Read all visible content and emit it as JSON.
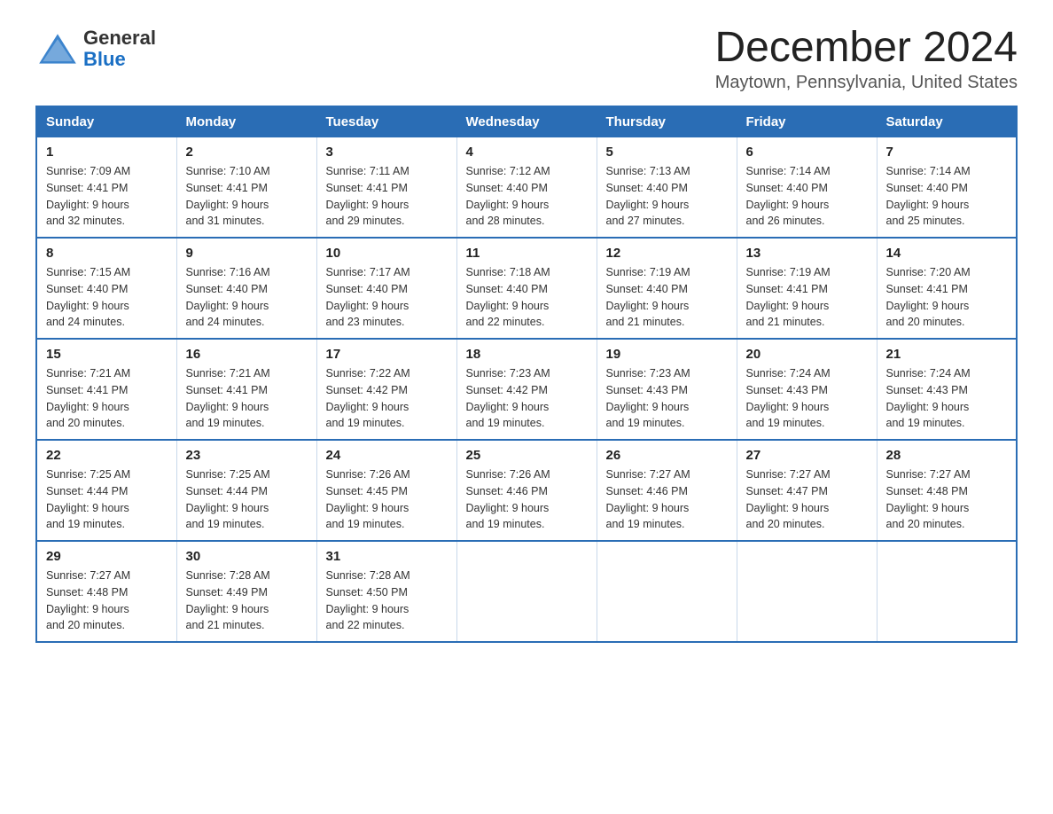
{
  "header": {
    "logo_line1": "General",
    "logo_line2": "Blue",
    "title": "December 2024",
    "location": "Maytown, Pennsylvania, United States"
  },
  "days_of_week": [
    "Sunday",
    "Monday",
    "Tuesday",
    "Wednesday",
    "Thursday",
    "Friday",
    "Saturday"
  ],
  "weeks": [
    [
      {
        "day": "1",
        "sunrise": "7:09 AM",
        "sunset": "4:41 PM",
        "daylight": "9 hours and 32 minutes."
      },
      {
        "day": "2",
        "sunrise": "7:10 AM",
        "sunset": "4:41 PM",
        "daylight": "9 hours and 31 minutes."
      },
      {
        "day": "3",
        "sunrise": "7:11 AM",
        "sunset": "4:41 PM",
        "daylight": "9 hours and 29 minutes."
      },
      {
        "day": "4",
        "sunrise": "7:12 AM",
        "sunset": "4:40 PM",
        "daylight": "9 hours and 28 minutes."
      },
      {
        "day": "5",
        "sunrise": "7:13 AM",
        "sunset": "4:40 PM",
        "daylight": "9 hours and 27 minutes."
      },
      {
        "day": "6",
        "sunrise": "7:14 AM",
        "sunset": "4:40 PM",
        "daylight": "9 hours and 26 minutes."
      },
      {
        "day": "7",
        "sunrise": "7:14 AM",
        "sunset": "4:40 PM",
        "daylight": "9 hours and 25 minutes."
      }
    ],
    [
      {
        "day": "8",
        "sunrise": "7:15 AM",
        "sunset": "4:40 PM",
        "daylight": "9 hours and 24 minutes."
      },
      {
        "day": "9",
        "sunrise": "7:16 AM",
        "sunset": "4:40 PM",
        "daylight": "9 hours and 24 minutes."
      },
      {
        "day": "10",
        "sunrise": "7:17 AM",
        "sunset": "4:40 PM",
        "daylight": "9 hours and 23 minutes."
      },
      {
        "day": "11",
        "sunrise": "7:18 AM",
        "sunset": "4:40 PM",
        "daylight": "9 hours and 22 minutes."
      },
      {
        "day": "12",
        "sunrise": "7:19 AM",
        "sunset": "4:40 PM",
        "daylight": "9 hours and 21 minutes."
      },
      {
        "day": "13",
        "sunrise": "7:19 AM",
        "sunset": "4:41 PM",
        "daylight": "9 hours and 21 minutes."
      },
      {
        "day": "14",
        "sunrise": "7:20 AM",
        "sunset": "4:41 PM",
        "daylight": "9 hours and 20 minutes."
      }
    ],
    [
      {
        "day": "15",
        "sunrise": "7:21 AM",
        "sunset": "4:41 PM",
        "daylight": "9 hours and 20 minutes."
      },
      {
        "day": "16",
        "sunrise": "7:21 AM",
        "sunset": "4:41 PM",
        "daylight": "9 hours and 19 minutes."
      },
      {
        "day": "17",
        "sunrise": "7:22 AM",
        "sunset": "4:42 PM",
        "daylight": "9 hours and 19 minutes."
      },
      {
        "day": "18",
        "sunrise": "7:23 AM",
        "sunset": "4:42 PM",
        "daylight": "9 hours and 19 minutes."
      },
      {
        "day": "19",
        "sunrise": "7:23 AM",
        "sunset": "4:43 PM",
        "daylight": "9 hours and 19 minutes."
      },
      {
        "day": "20",
        "sunrise": "7:24 AM",
        "sunset": "4:43 PM",
        "daylight": "9 hours and 19 minutes."
      },
      {
        "day": "21",
        "sunrise": "7:24 AM",
        "sunset": "4:43 PM",
        "daylight": "9 hours and 19 minutes."
      }
    ],
    [
      {
        "day": "22",
        "sunrise": "7:25 AM",
        "sunset": "4:44 PM",
        "daylight": "9 hours and 19 minutes."
      },
      {
        "day": "23",
        "sunrise": "7:25 AM",
        "sunset": "4:44 PM",
        "daylight": "9 hours and 19 minutes."
      },
      {
        "day": "24",
        "sunrise": "7:26 AM",
        "sunset": "4:45 PM",
        "daylight": "9 hours and 19 minutes."
      },
      {
        "day": "25",
        "sunrise": "7:26 AM",
        "sunset": "4:46 PM",
        "daylight": "9 hours and 19 minutes."
      },
      {
        "day": "26",
        "sunrise": "7:27 AM",
        "sunset": "4:46 PM",
        "daylight": "9 hours and 19 minutes."
      },
      {
        "day": "27",
        "sunrise": "7:27 AM",
        "sunset": "4:47 PM",
        "daylight": "9 hours and 20 minutes."
      },
      {
        "day": "28",
        "sunrise": "7:27 AM",
        "sunset": "4:48 PM",
        "daylight": "9 hours and 20 minutes."
      }
    ],
    [
      {
        "day": "29",
        "sunrise": "7:27 AM",
        "sunset": "4:48 PM",
        "daylight": "9 hours and 20 minutes."
      },
      {
        "day": "30",
        "sunrise": "7:28 AM",
        "sunset": "4:49 PM",
        "daylight": "9 hours and 21 minutes."
      },
      {
        "day": "31",
        "sunrise": "7:28 AM",
        "sunset": "4:50 PM",
        "daylight": "9 hours and 22 minutes."
      },
      null,
      null,
      null,
      null
    ]
  ],
  "labels": {
    "sunrise": "Sunrise:",
    "sunset": "Sunset:",
    "daylight": "Daylight:"
  }
}
